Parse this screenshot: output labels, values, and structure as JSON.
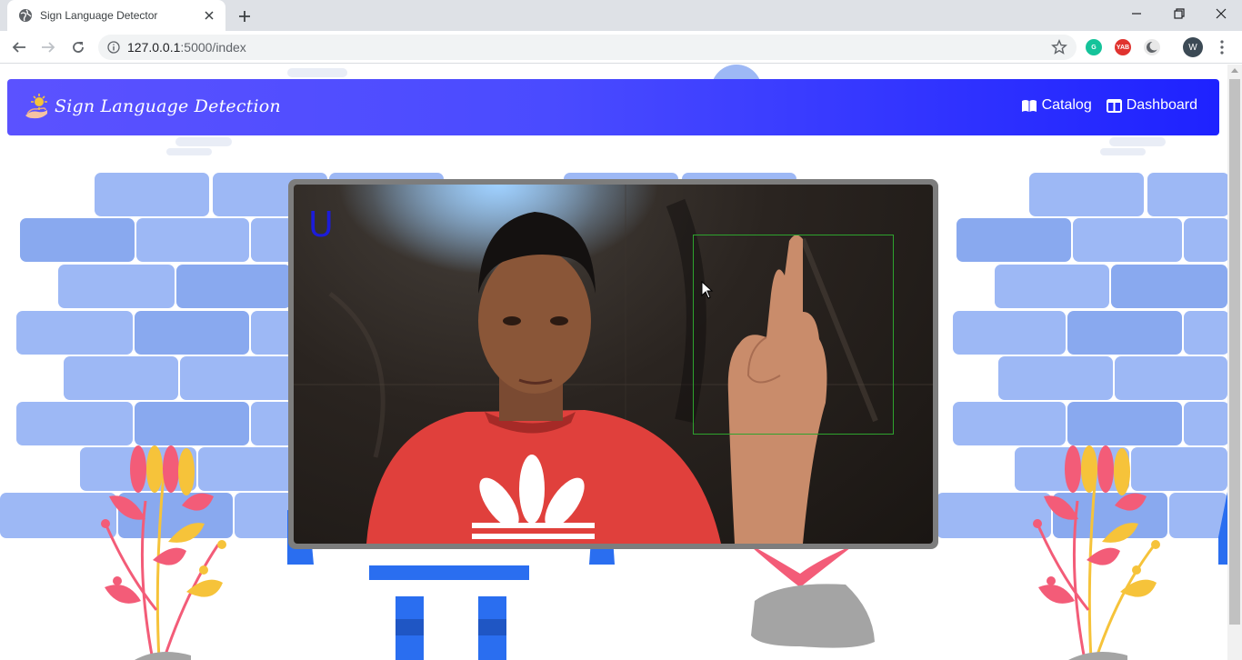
{
  "browser": {
    "tab_title": "Sign Language Detector",
    "url_host": "127.0.0.1",
    "url_path": ":5000/index",
    "profile_initial": "W",
    "icons": [
      "globe-icon",
      "close-icon",
      "plus-icon",
      "minimize-icon",
      "restore-icon",
      "window-close-icon",
      "back-icon",
      "forward-icon",
      "reload-icon",
      "info-icon",
      "star-icon",
      "grammarly-icon",
      "yab-icon",
      "dark-mode-icon",
      "more-icon"
    ]
  },
  "navbar": {
    "brand": "Sign Language Detection",
    "links": [
      {
        "label": "Catalog",
        "icon": "book-icon"
      },
      {
        "label": "Dashboard",
        "icon": "columns-icon"
      }
    ],
    "gradient": [
      "#5b52ff",
      "#1e22ff"
    ]
  },
  "video": {
    "prediction_letter": "U",
    "roi_color": "#2ea32e",
    "prediction_color": "#1c1cd9"
  },
  "colors": {
    "bricks": "#9db8f5",
    "bricks_dark": "#89a9ef",
    "flower_pink": "#f35c78",
    "flower_yellow": "#f6c33a",
    "pedestal_blue": "#2a6ef0"
  }
}
